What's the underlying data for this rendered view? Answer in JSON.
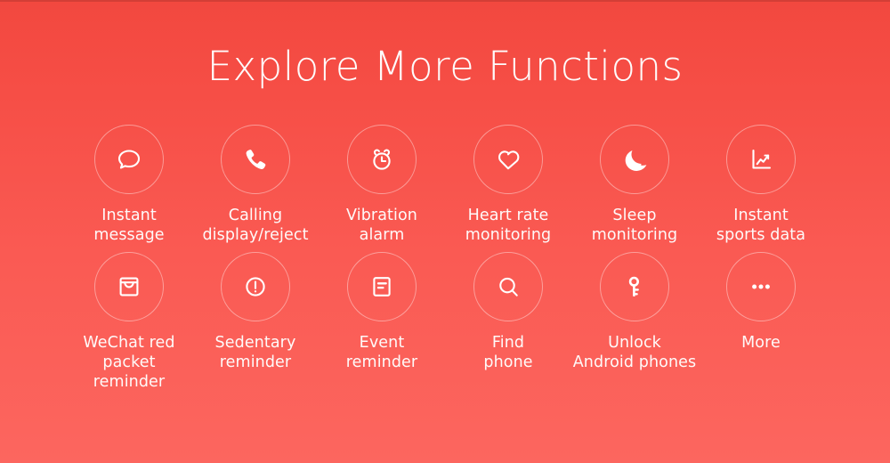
{
  "theme": {
    "background_top": "#F2483F",
    "background_bottom": "#FC665F",
    "text_color": "#FFFFFF",
    "ring_color": "rgba(255,255,255,0.42)"
  },
  "header": {
    "title": "Explore More Functions"
  },
  "features": {
    "row1": [
      {
        "icon": "speech-bubble-icon",
        "label": "Instant\nmessage"
      },
      {
        "icon": "phone-call-icon",
        "label": "Calling\ndisplay/reject"
      },
      {
        "icon": "alarm-clock-icon",
        "label": "Vibration\nalarm"
      },
      {
        "icon": "heart-icon",
        "label": "Heart rate\nmonitoring"
      },
      {
        "icon": "crescent-moon-icon",
        "label": "Sleep\nmonitoring"
      },
      {
        "icon": "line-chart-icon",
        "label": "Instant\nsports data"
      }
    ],
    "row2": [
      {
        "icon": "envelope-icon",
        "label": "WeChat red\npacket reminder"
      },
      {
        "icon": "exclamation-circle-icon",
        "label": "Sedentary\nreminder"
      },
      {
        "icon": "document-note-icon",
        "label": "Event\nreminder"
      },
      {
        "icon": "magnifier-icon",
        "label": "Find\nphone"
      },
      {
        "icon": "key-icon",
        "label": "Unlock\nAndroid phones"
      },
      {
        "icon": "ellipsis-icon",
        "label": "More"
      }
    ]
  }
}
